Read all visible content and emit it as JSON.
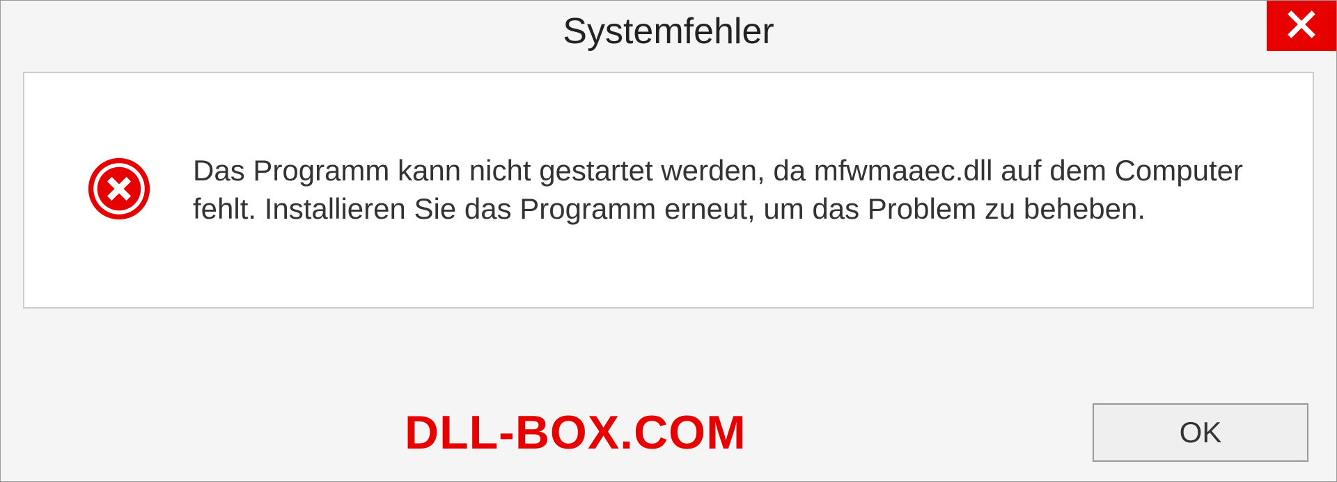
{
  "dialog": {
    "title": "Systemfehler",
    "message": "Das Programm kann nicht gestartet werden, da mfwmaaec.dll auf dem Computer fehlt. Installieren Sie das Programm erneut, um das Problem zu beheben.",
    "ok_label": "OK"
  },
  "watermark": "DLL-BOX.COM"
}
